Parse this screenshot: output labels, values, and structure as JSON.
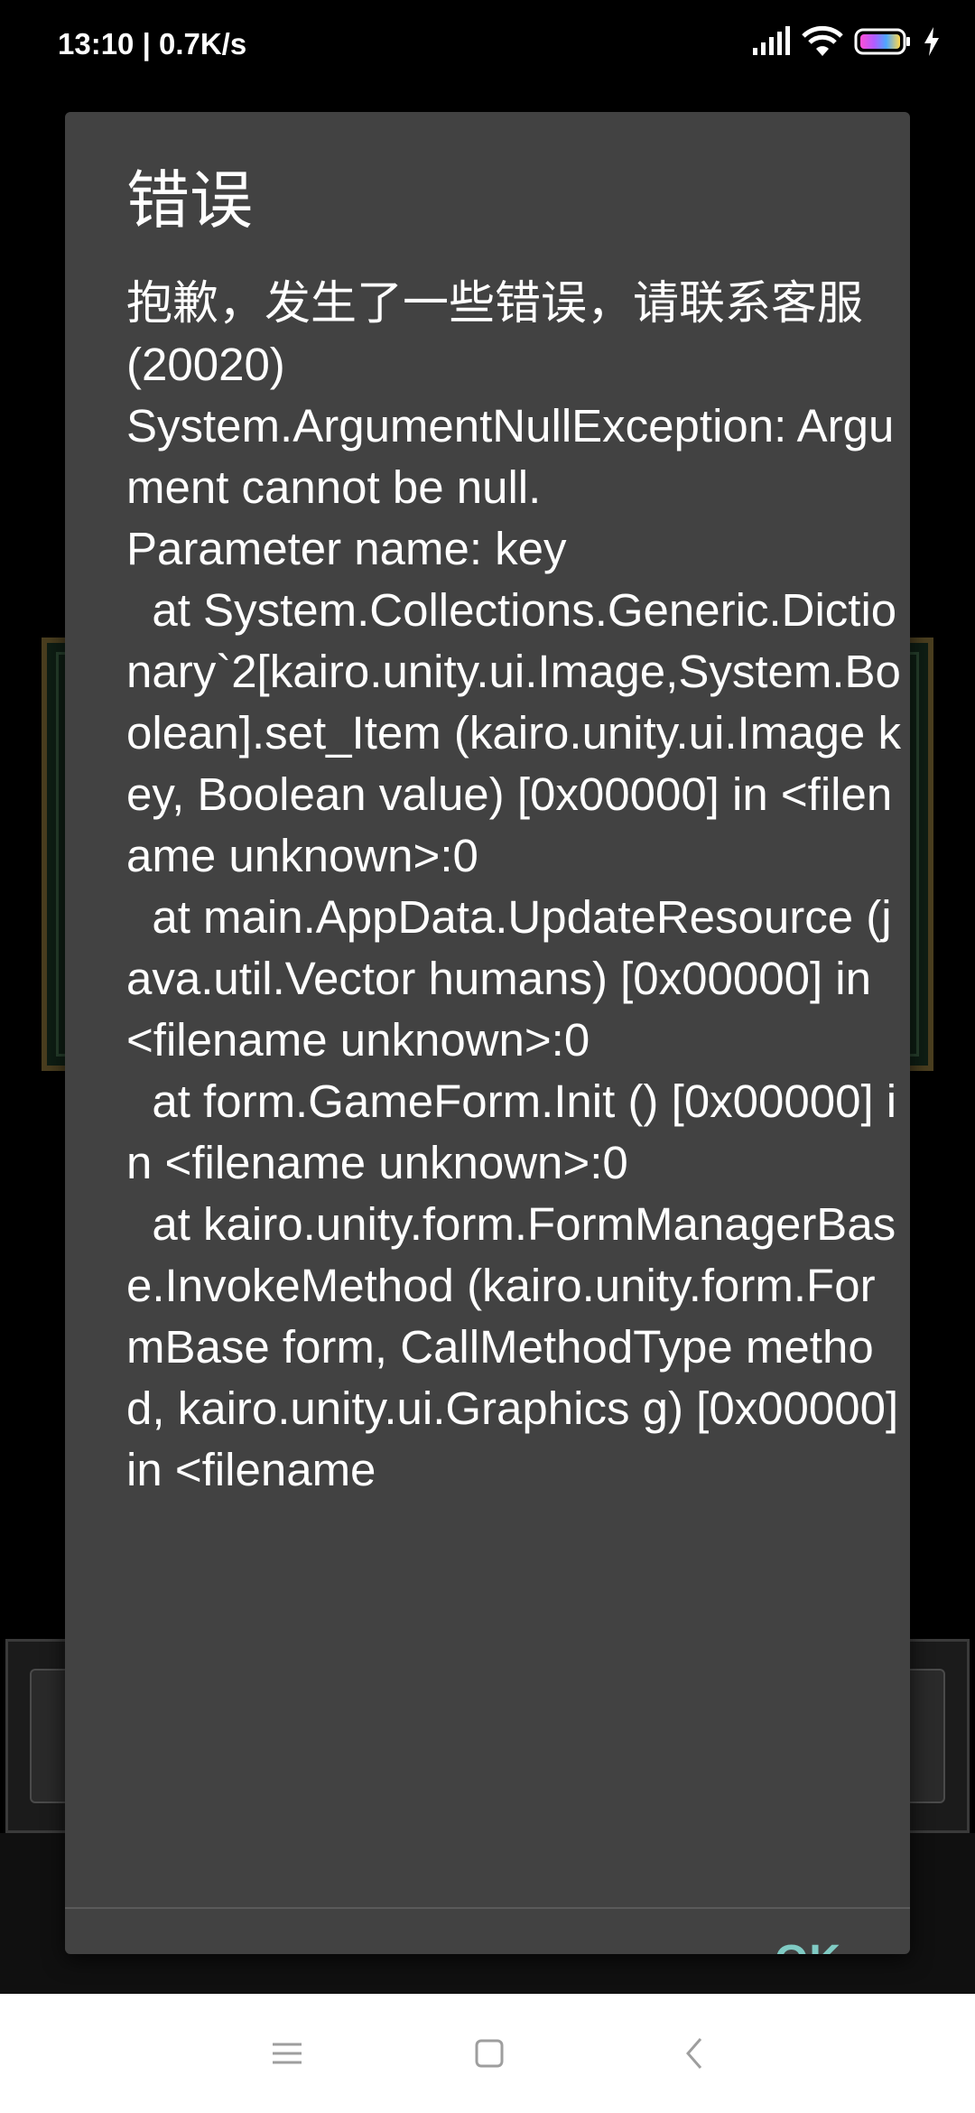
{
  "status_bar": {
    "time_speed": "13:10 | 0.7K/s",
    "icons": [
      "signal-icon",
      "wifi-icon",
      "battery-icon",
      "charging-icon"
    ]
  },
  "dialog": {
    "title": "错误",
    "message": "抱歉，发生了一些错误，请联系客服(20020)\nSystem.ArgumentNullException: Argument cannot be null.\nParameter name: key\n  at System.Collections.Generic.Dictionary`2[kairo.unity.ui.Image,System.Boolean].set_Item (kairo.unity.ui.Image key, Boolean value) [0x00000] in <filename unknown>:0\n  at main.AppData.UpdateResource (java.util.Vector humans) [0x00000] in <filename unknown>:0\n  at form.GameForm.Init () [0x00000] in <filename unknown>:0\n  at kairo.unity.form.FormManagerBase.InvokeMethod (kairo.unity.form.FormBase form, CallMethodType method, kairo.unity.ui.Graphics g) [0x00000] in <filename",
    "ok_label": "OK"
  },
  "colors": {
    "dialog_background": "#424242",
    "accent": "#80cbc4",
    "text": "#ffffff"
  },
  "nav_bar": {
    "buttons": [
      "menu-icon",
      "home-icon",
      "back-icon"
    ]
  }
}
